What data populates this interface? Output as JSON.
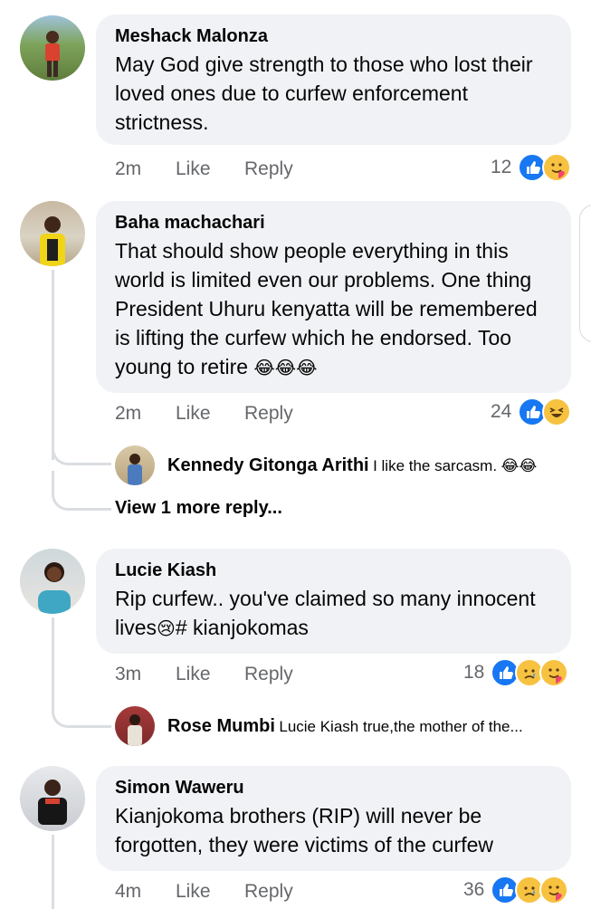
{
  "comments": [
    {
      "name": "Meshack Malonza",
      "text": "May God give strength to those who lost their loved ones due to curfew enforcement strictness.",
      "time": "2m",
      "like": "Like",
      "reply": "Reply",
      "reaction_count": "12",
      "reactions": [
        "like-icon",
        "care-icon"
      ]
    },
    {
      "name": "Baha machachari",
      "text": "That should show people everything in this world is limited even our problems. One thing President Uhuru kenyatta will be remembered is lifting the curfew which he endorsed. Too young to retire",
      "emojis": "😂😂😂",
      "time": "2m",
      "like": "Like",
      "reply": "Reply",
      "reaction_count": "24",
      "reactions": [
        "like-icon",
        "haha-icon"
      ],
      "replies": [
        {
          "name": "Kennedy Gitonga Arithi",
          "text": "I like the sarcasm.",
          "emojis": "😂😂"
        }
      ],
      "view_more": "View 1 more reply..."
    },
    {
      "name": "Lucie Kiash",
      "text_part1": "Rip curfew.. you've claimed so many innocent lives",
      "emoji": "😢",
      "text_part2": "# kianjokomas",
      "time": "3m",
      "like": "Like",
      "reply": "Reply",
      "reaction_count": "18",
      "reactions": [
        "like-icon",
        "sad-icon",
        "care-icon"
      ],
      "replies": [
        {
          "name": "Rose Mumbi",
          "text": "Lucie Kiash true,the mother of the..."
        }
      ]
    },
    {
      "name": "Simon Waweru",
      "text": "Kianjokoma brothers (RIP) will never be forgotten, they were victims of the curfew",
      "time": "4m",
      "like": "Like",
      "reply": "Reply",
      "reaction_count": "36",
      "reactions": [
        "like-icon",
        "sad-icon",
        "care-icon"
      ]
    }
  ],
  "colors": {
    "bubble": "#f0f2f5",
    "meta_text": "#65676b",
    "like_blue": "#1877f2",
    "emoji_yellow": "#f7c240",
    "thread_line": "#dadde1"
  }
}
